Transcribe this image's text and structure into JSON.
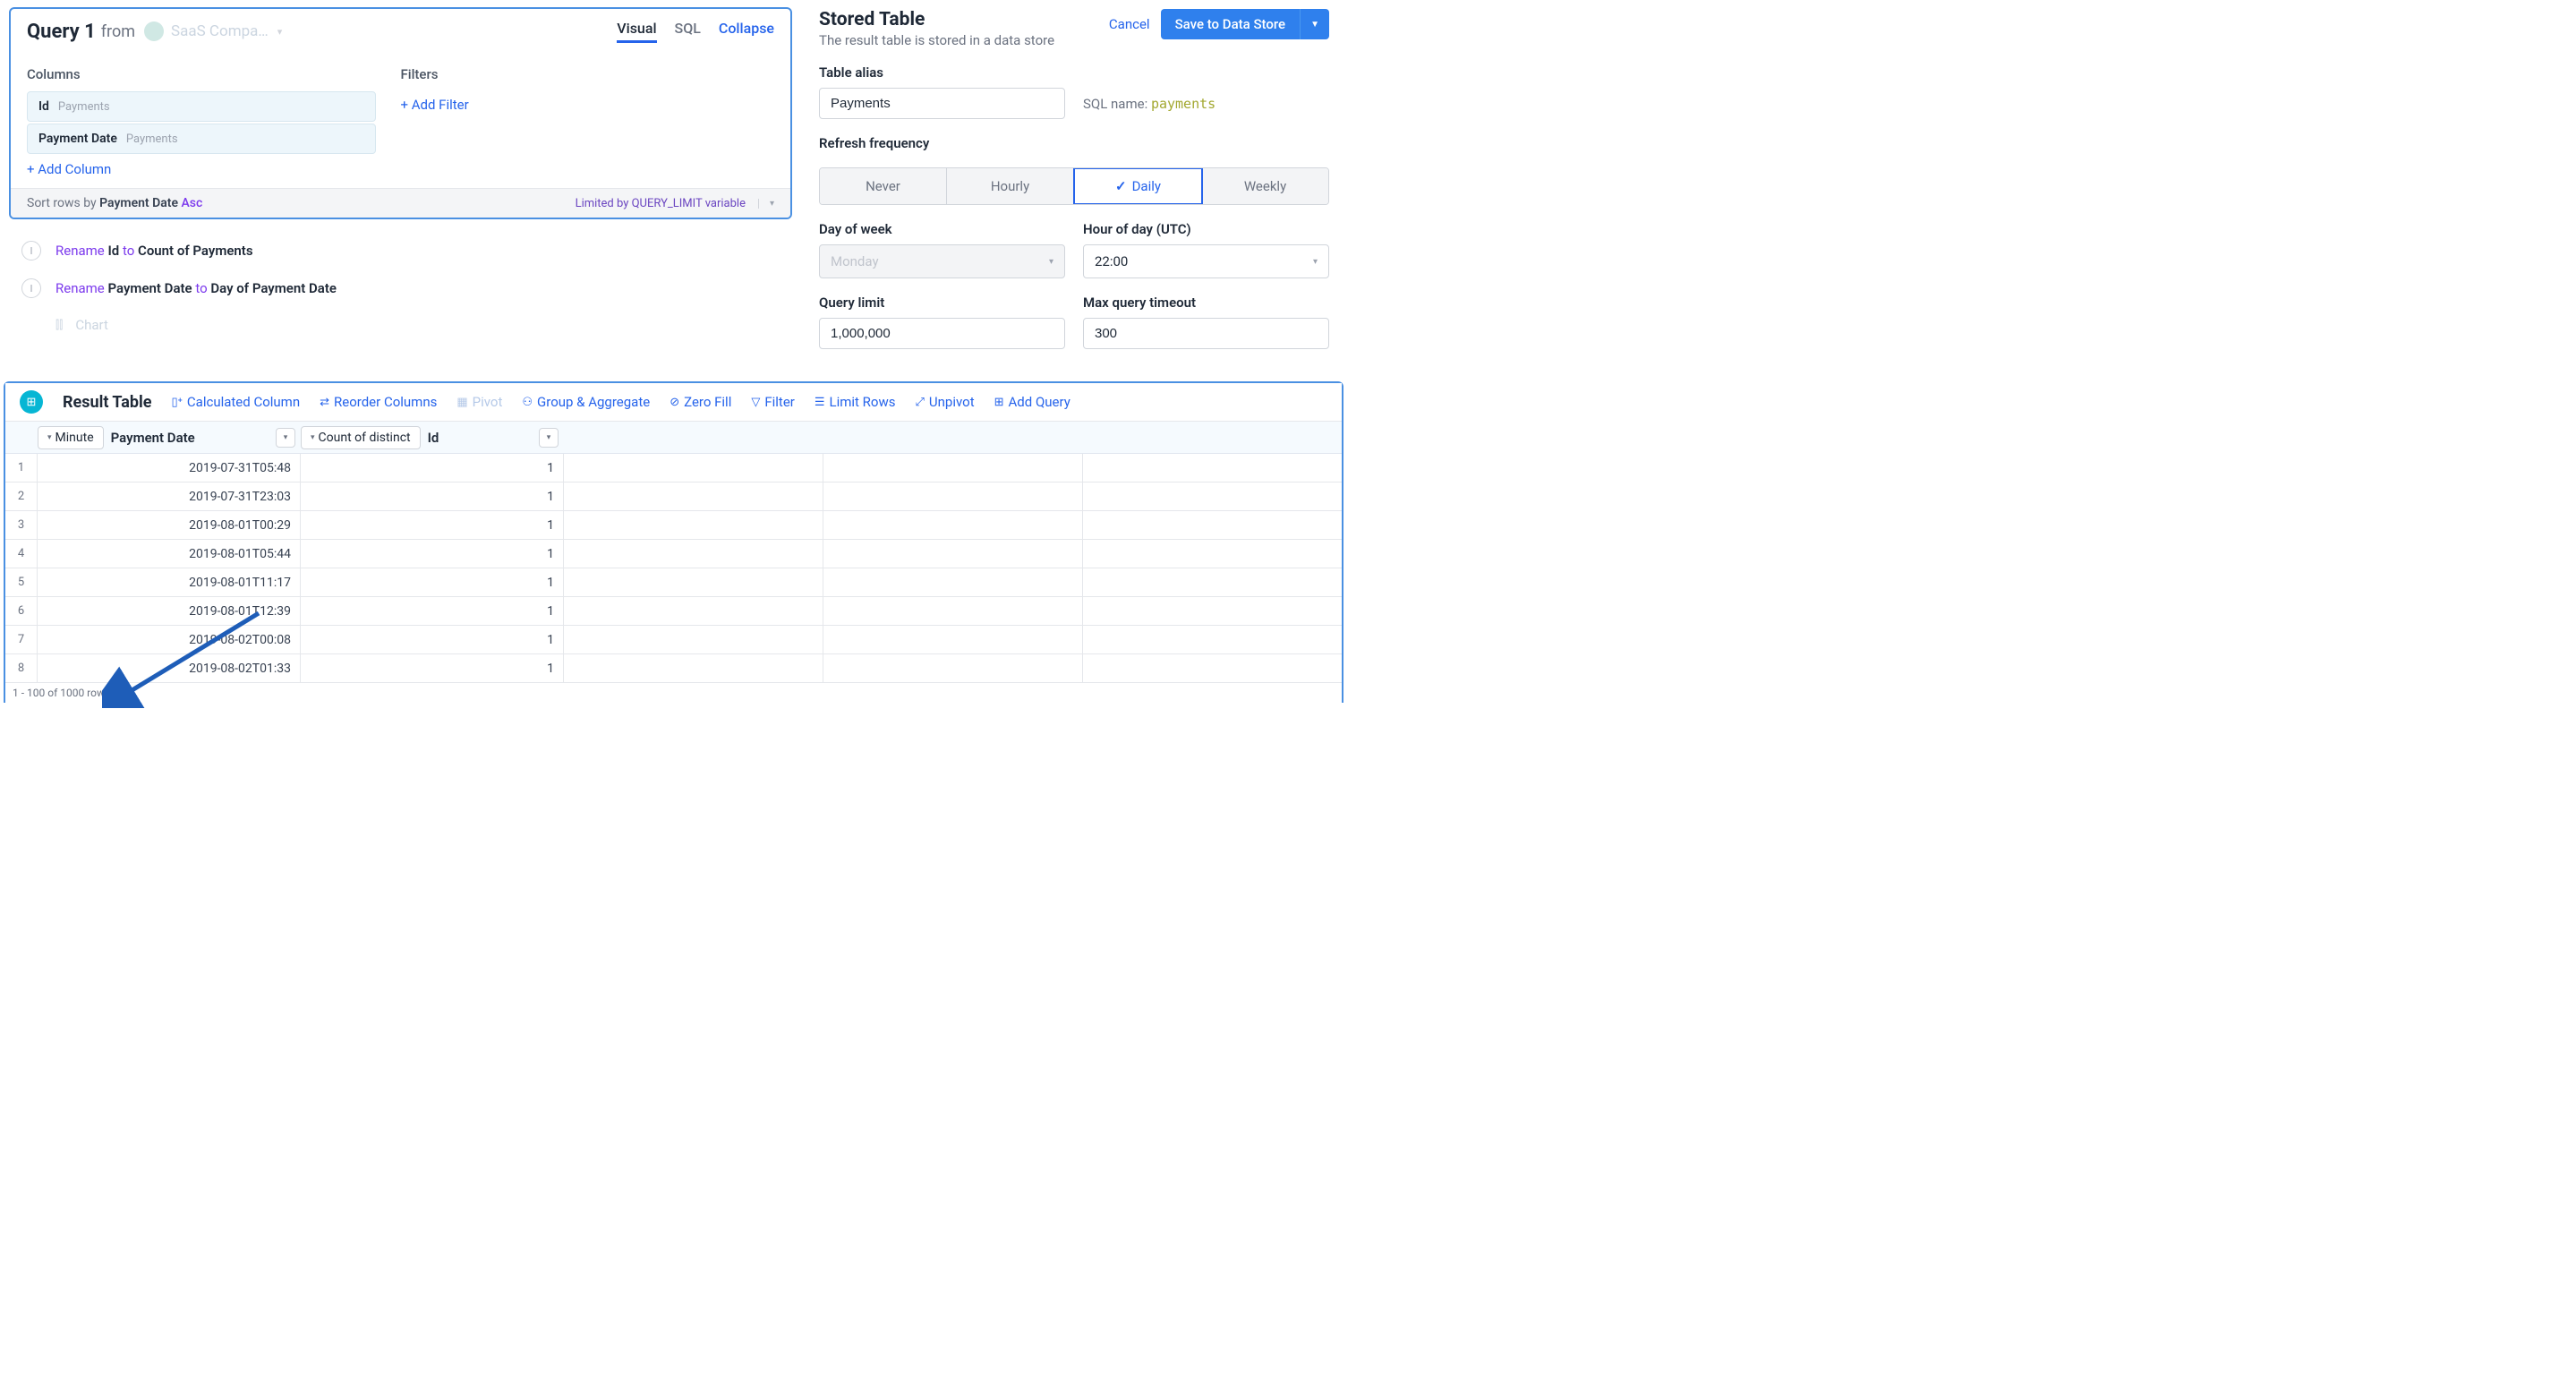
{
  "query": {
    "title": "Query 1",
    "from_label": "from",
    "source": "SaaS Compa…",
    "tabs": {
      "visual": "Visual",
      "sql": "SQL",
      "collapse": "Collapse"
    },
    "columns_label": "Columns",
    "filters_label": "Filters",
    "columns": [
      {
        "name": "Id",
        "sub": "Payments"
      },
      {
        "name": "Payment Date",
        "sub": "Payments"
      }
    ],
    "add_column": "+ Add Column",
    "add_filter": "+ Add Filter",
    "sort_prefix": "Sort rows by ",
    "sort_field": "Payment Date ",
    "sort_dir": "Asc",
    "limit_text": "Limited by QUERY_LIMIT variable",
    "steps": [
      {
        "pre": "Rename ",
        "a": "Id",
        "mid": " to ",
        "b": "Count of Payments"
      },
      {
        "pre": "Rename ",
        "a": "Payment Date",
        "mid": " to ",
        "b": "Day of Payment Date"
      }
    ],
    "chart_label": "Chart"
  },
  "stored": {
    "title": "Stored Table",
    "subtitle": "The result table is stored in a data store",
    "cancel": "Cancel",
    "save": "Save to Data Store",
    "alias_label": "Table alias",
    "alias_value": "Payments",
    "sql_name_label": "SQL name: ",
    "sql_name_value": "payments",
    "refresh_label": "Refresh frequency",
    "freq": {
      "never": "Never",
      "hourly": "Hourly",
      "daily": "Daily",
      "weekly": "Weekly"
    },
    "dow_label": "Day of week",
    "dow_value": "Monday",
    "hod_label": "Hour of day (UTC)",
    "hod_value": "22:00",
    "qlimit_label": "Query limit",
    "qlimit_value": "1,000,000",
    "timeout_label": "Max query timeout",
    "timeout_value": "300"
  },
  "result": {
    "title": "Result Table",
    "actions": {
      "calc": "Calculated Column",
      "reorder": "Reorder Columns",
      "pivot": "Pivot",
      "group": "Group & Aggregate",
      "zero": "Zero Fill",
      "filter": "Filter",
      "limit": "Limit Rows",
      "unpivot": "Unpivot",
      "addq": "Add Query"
    },
    "headers": [
      {
        "btn": "Minute",
        "label": "Payment Date"
      },
      {
        "btn": "Count of distinct",
        "label": "Id"
      }
    ],
    "rows": [
      {
        "n": "1",
        "a": "2019-07-31T05:48",
        "b": "1"
      },
      {
        "n": "2",
        "a": "2019-07-31T23:03",
        "b": "1"
      },
      {
        "n": "3",
        "a": "2019-08-01T00:29",
        "b": "1"
      },
      {
        "n": "4",
        "a": "2019-08-01T05:44",
        "b": "1"
      },
      {
        "n": "5",
        "a": "2019-08-01T11:17",
        "b": "1"
      },
      {
        "n": "6",
        "a": "2019-08-01T12:39",
        "b": "1"
      },
      {
        "n": "7",
        "a": "2019-08-02T00:08",
        "b": "1"
      },
      {
        "n": "8",
        "a": "2019-08-02T01:33",
        "b": "1"
      }
    ],
    "footer": "1 - 100 of 1000 rows"
  }
}
